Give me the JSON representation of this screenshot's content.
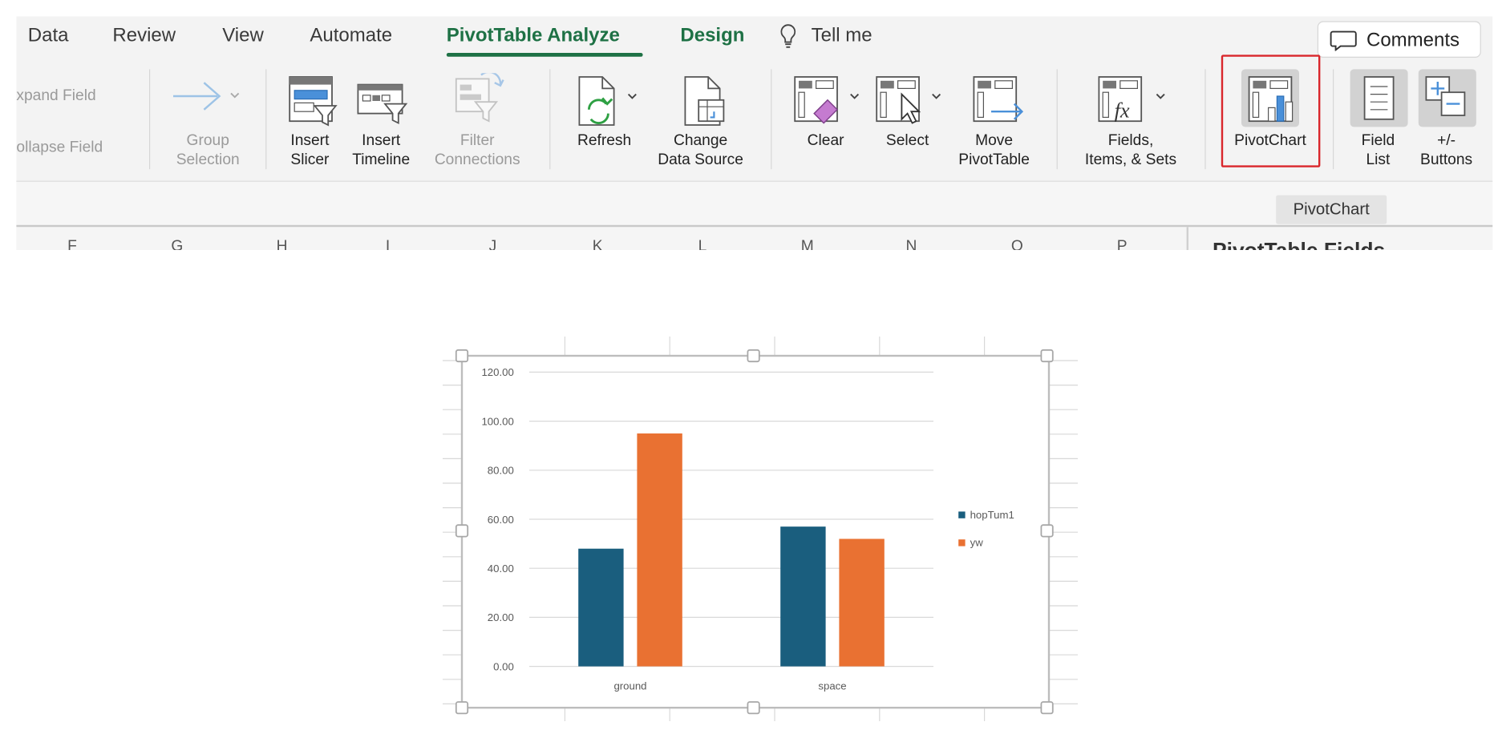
{
  "ribbon": {
    "tabs": [
      {
        "label": "Data"
      },
      {
        "label": "Review"
      },
      {
        "label": "View"
      },
      {
        "label": "Automate"
      },
      {
        "label": "PivotTable Analyze",
        "active": true
      },
      {
        "label": "Design"
      }
    ],
    "tell_me": "Tell me",
    "comments_button": "Comments",
    "expand_field": "xpand Field",
    "collapse_field": "ollapse Field",
    "group_selection": [
      "Group",
      "Selection"
    ],
    "insert_slicer": [
      "Insert",
      "Slicer"
    ],
    "insert_timeline": [
      "Insert",
      "Timeline"
    ],
    "filter_connections": [
      "Filter",
      "Connections"
    ],
    "refresh": "Refresh",
    "change_data_source": [
      "Change",
      "Data Source"
    ],
    "clear": "Clear",
    "select": "Select",
    "move_pivottable": [
      "Move",
      "PivotTable"
    ],
    "fields_items_sets": [
      "Fields,",
      "Items, & Sets"
    ],
    "pivotchart": "PivotChart",
    "field_list": [
      "Field",
      "List"
    ],
    "plus_minus_buttons": [
      "+/-",
      "Buttons"
    ],
    "tooltip": "PivotChart"
  },
  "sheet": {
    "column_headers": [
      "F",
      "G",
      "H",
      "I",
      "J",
      "K",
      "L",
      "M",
      "N",
      "O",
      "P"
    ],
    "pane_title": "PivotTable Fields"
  },
  "colors": {
    "accent_green": "#1e7145",
    "highlight_red": "#d9262b",
    "series_blue": "#1a5e7e",
    "series_orange": "#e97132"
  },
  "chart_data": {
    "type": "bar",
    "categories": [
      "ground",
      "space"
    ],
    "series": [
      {
        "name": "hopTum1",
        "values": [
          48,
          57
        ],
        "color": "#1a5e7e"
      },
      {
        "name": "yw",
        "values": [
          95,
          52
        ],
        "color": "#e97132"
      }
    ],
    "y_ticks": [
      "0.00",
      "20.00",
      "40.00",
      "60.00",
      "80.00",
      "100.00",
      "120.00"
    ],
    "ylim": [
      0,
      120
    ],
    "grid": true,
    "legend_position": "right"
  }
}
